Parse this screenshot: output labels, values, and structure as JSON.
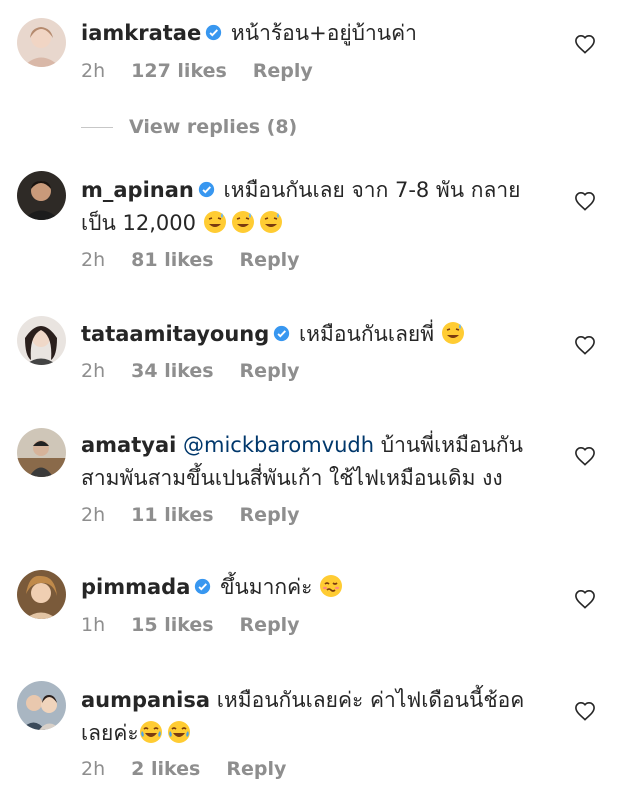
{
  "comments": [
    {
      "username": "iamkratae",
      "verified": true,
      "mention": "",
      "text": "หน้าร้อน+อยู่บ้านค่า",
      "text2": "",
      "time": "2h",
      "likes": "127 likes",
      "reply": "Reply",
      "avatar_color": "#d9b8a8"
    },
    {
      "username": "m_apinan",
      "verified": true,
      "mention": "",
      "text": "เหมือนกันเลย จาก 7-8 พัน กลาย",
      "text2": "เป็น 12,000",
      "time": "2h",
      "likes": "81 likes",
      "reply": "Reply",
      "avatar_color": "#5a4636"
    },
    {
      "username": "tataamitayoung",
      "verified": true,
      "mention": "",
      "text": "เหมือนกันเลยพี่",
      "text2": "",
      "time": "2h",
      "likes": "34 likes",
      "reply": "Reply",
      "avatar_color": "#3a2d2a"
    },
    {
      "username": "amatyai",
      "verified": false,
      "mention": "@mickbaromvudh",
      "text": "บ้านพี่เหมือนกัน",
      "text2": "สามพันสามขึ้นเปนสี่พันเก้า ใช้ไฟเหมือนเดิม งง",
      "time": "2h",
      "likes": "11 likes",
      "reply": "Reply",
      "avatar_color": "#8a7a6a"
    },
    {
      "username": "pimmada",
      "verified": true,
      "mention": "",
      "text": "ขึ้นมากค่ะ",
      "text2": "",
      "time": "1h",
      "likes": "15 likes",
      "reply": "Reply",
      "avatar_color": "#c89a6a"
    },
    {
      "username": "aumpanisa",
      "verified": false,
      "mention": "",
      "text": "เหมือนกันเลยค่ะ ค่าไฟเดือนนี้ช้อค",
      "text2": "เลยค่ะ",
      "time": "2h",
      "likes": "2 likes",
      "reply": "Reply",
      "avatar_color": "#7a8a9a"
    }
  ],
  "view_replies": "View replies (8)",
  "icons": {
    "like": "heart-outline-icon",
    "verified": "verified-badge-icon"
  },
  "colors": {
    "verified": "#3897f0",
    "mention": "#00376b",
    "meta": "#8e8e8e"
  }
}
